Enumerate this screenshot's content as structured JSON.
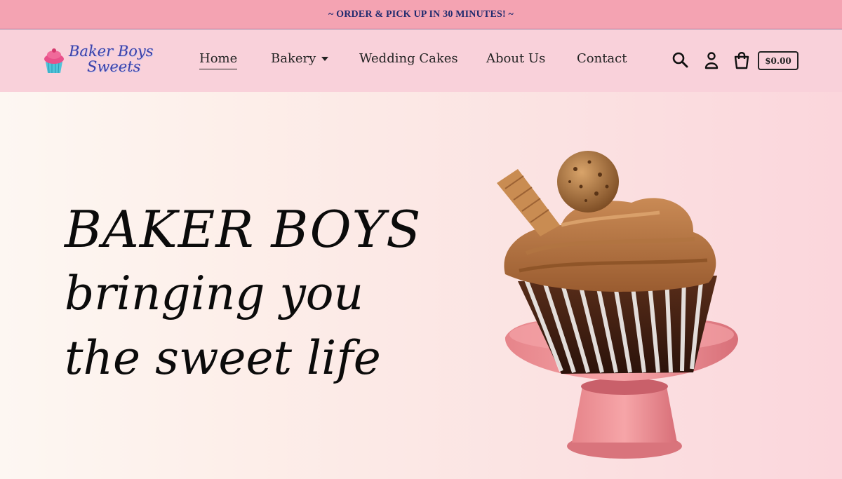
{
  "announcement": "~ ORDER & PICK UP IN 30 MINUTES! ~",
  "logo": {
    "line1": "Baker Boys",
    "line2": "Sweets"
  },
  "nav": {
    "items": [
      {
        "label": "Home"
      },
      {
        "label": "Bakery"
      },
      {
        "label": "Wedding Cakes"
      },
      {
        "label": "About Us"
      },
      {
        "label": "Contact"
      }
    ]
  },
  "header_icons": [
    "search-icon",
    "account-icon",
    "cart-icon"
  ],
  "cart": {
    "total": "$0.00"
  },
  "hero": {
    "line1": "BAKER BOYS",
    "line2": "bringing you",
    "line3": "the sweet life"
  },
  "colors": {
    "announcement_bg": "#f4a3b2",
    "announcement_text": "#1f2a6e",
    "header_bg": "#f9d1da",
    "logo_text": "#3b3fa8"
  }
}
